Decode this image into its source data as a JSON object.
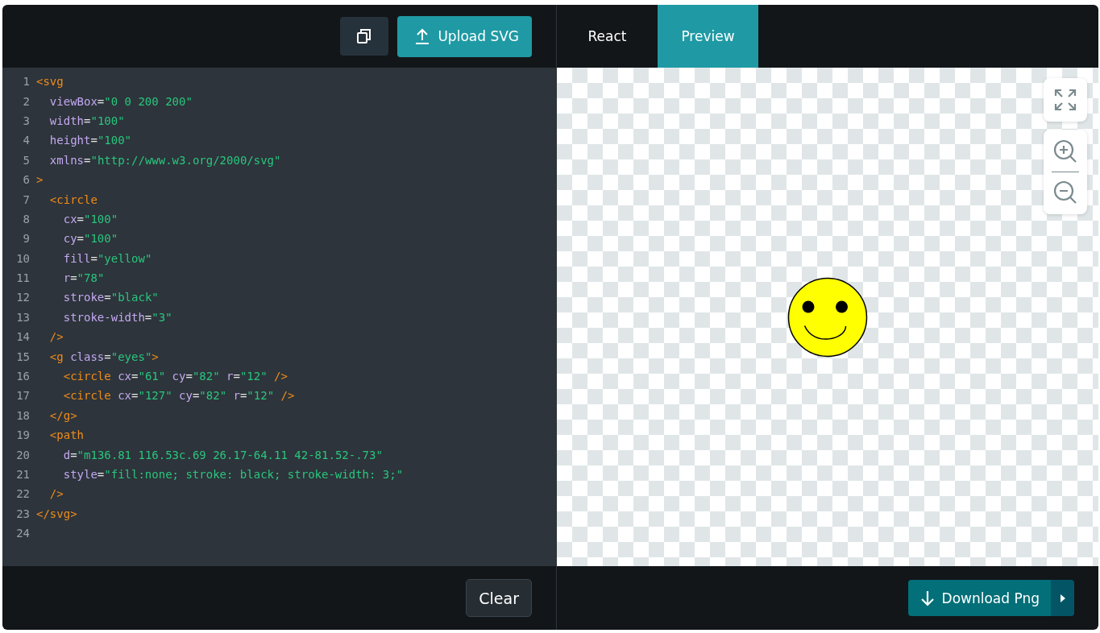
{
  "editor": {
    "upload_button": "Upload SVG",
    "clear_button": "Clear",
    "lines": [
      {
        "number": "1",
        "tokens": [
          {
            "kind": "tag",
            "text": "<svg"
          }
        ]
      },
      {
        "number": "2",
        "tokens": [
          {
            "kind": "attr",
            "text": "  viewBox"
          },
          {
            "kind": "plain",
            "text": "="
          },
          {
            "kind": "string",
            "text": "\"0 0 200 200\""
          }
        ]
      },
      {
        "number": "3",
        "tokens": [
          {
            "kind": "attr",
            "text": "  width"
          },
          {
            "kind": "plain",
            "text": "="
          },
          {
            "kind": "string",
            "text": "\"100\""
          }
        ]
      },
      {
        "number": "4",
        "tokens": [
          {
            "kind": "attr",
            "text": "  height"
          },
          {
            "kind": "plain",
            "text": "="
          },
          {
            "kind": "string",
            "text": "\"100\""
          }
        ]
      },
      {
        "number": "5",
        "tokens": [
          {
            "kind": "attr",
            "text": "  xmlns"
          },
          {
            "kind": "plain",
            "text": "="
          },
          {
            "kind": "string",
            "text": "\"http://www.w3.org/2000/svg\""
          }
        ]
      },
      {
        "number": "6",
        "tokens": [
          {
            "kind": "tag",
            "text": ">"
          }
        ]
      },
      {
        "number": "7",
        "tokens": [
          {
            "kind": "tag",
            "text": "  <circle"
          }
        ]
      },
      {
        "number": "8",
        "tokens": [
          {
            "kind": "attr",
            "text": "    cx"
          },
          {
            "kind": "plain",
            "text": "="
          },
          {
            "kind": "string",
            "text": "\"100\""
          }
        ]
      },
      {
        "number": "9",
        "tokens": [
          {
            "kind": "attr",
            "text": "    cy"
          },
          {
            "kind": "plain",
            "text": "="
          },
          {
            "kind": "string",
            "text": "\"100\""
          }
        ]
      },
      {
        "number": "10",
        "tokens": [
          {
            "kind": "attr",
            "text": "    fill"
          },
          {
            "kind": "plain",
            "text": "="
          },
          {
            "kind": "string",
            "text": "\"yellow\""
          }
        ]
      },
      {
        "number": "11",
        "tokens": [
          {
            "kind": "attr",
            "text": "    r"
          },
          {
            "kind": "plain",
            "text": "="
          },
          {
            "kind": "string",
            "text": "\"78\""
          }
        ]
      },
      {
        "number": "12",
        "tokens": [
          {
            "kind": "attr",
            "text": "    stroke"
          },
          {
            "kind": "plain",
            "text": "="
          },
          {
            "kind": "string",
            "text": "\"black\""
          }
        ]
      },
      {
        "number": "13",
        "tokens": [
          {
            "kind": "attr",
            "text": "    stroke-width"
          },
          {
            "kind": "plain",
            "text": "="
          },
          {
            "kind": "string",
            "text": "\"3\""
          }
        ]
      },
      {
        "number": "14",
        "tokens": [
          {
            "kind": "tag",
            "text": "  />"
          }
        ]
      },
      {
        "number": "15",
        "tokens": [
          {
            "kind": "tag",
            "text": "  <g"
          },
          {
            "kind": "attr",
            "text": " class"
          },
          {
            "kind": "plain",
            "text": "="
          },
          {
            "kind": "string",
            "text": "\"eyes\""
          },
          {
            "kind": "tag",
            "text": ">"
          }
        ]
      },
      {
        "number": "16",
        "tokens": [
          {
            "kind": "tag",
            "text": "    <circle"
          },
          {
            "kind": "attr",
            "text": " cx"
          },
          {
            "kind": "plain",
            "text": "="
          },
          {
            "kind": "string",
            "text": "\"61\""
          },
          {
            "kind": "attr",
            "text": " cy"
          },
          {
            "kind": "plain",
            "text": "="
          },
          {
            "kind": "string",
            "text": "\"82\""
          },
          {
            "kind": "attr",
            "text": " r"
          },
          {
            "kind": "plain",
            "text": "="
          },
          {
            "kind": "string",
            "text": "\"12\""
          },
          {
            "kind": "tag",
            "text": " />"
          }
        ]
      },
      {
        "number": "17",
        "tokens": [
          {
            "kind": "tag",
            "text": "    <circle"
          },
          {
            "kind": "attr",
            "text": " cx"
          },
          {
            "kind": "plain",
            "text": "="
          },
          {
            "kind": "string",
            "text": "\"127\""
          },
          {
            "kind": "attr",
            "text": " cy"
          },
          {
            "kind": "plain",
            "text": "="
          },
          {
            "kind": "string",
            "text": "\"82\""
          },
          {
            "kind": "attr",
            "text": " r"
          },
          {
            "kind": "plain",
            "text": "="
          },
          {
            "kind": "string",
            "text": "\"12\""
          },
          {
            "kind": "tag",
            "text": " />"
          }
        ]
      },
      {
        "number": "18",
        "tokens": [
          {
            "kind": "tag",
            "text": "  </g>"
          }
        ]
      },
      {
        "number": "19",
        "tokens": [
          {
            "kind": "tag",
            "text": "  <path"
          }
        ]
      },
      {
        "number": "20",
        "tokens": [
          {
            "kind": "attr",
            "text": "    d"
          },
          {
            "kind": "plain",
            "text": "="
          },
          {
            "kind": "string",
            "text": "\"m136.81 116.53c.69 26.17-64.11 42-81.52-.73\""
          }
        ]
      },
      {
        "number": "21",
        "tokens": [
          {
            "kind": "attr",
            "text": "    style"
          },
          {
            "kind": "plain",
            "text": "="
          },
          {
            "kind": "string",
            "text": "\"fill:none; stroke: black; stroke-width: 3;\""
          }
        ]
      },
      {
        "number": "22",
        "tokens": [
          {
            "kind": "tag",
            "text": "  />"
          }
        ]
      },
      {
        "number": "23",
        "tokens": [
          {
            "kind": "tag",
            "text": "</svg>"
          }
        ]
      },
      {
        "number": "24"
      }
    ]
  },
  "preview": {
    "tabs": [
      {
        "label": "React",
        "selected": false
      },
      {
        "label": "Preview",
        "selected": true
      }
    ],
    "download_button": "Download Png"
  }
}
